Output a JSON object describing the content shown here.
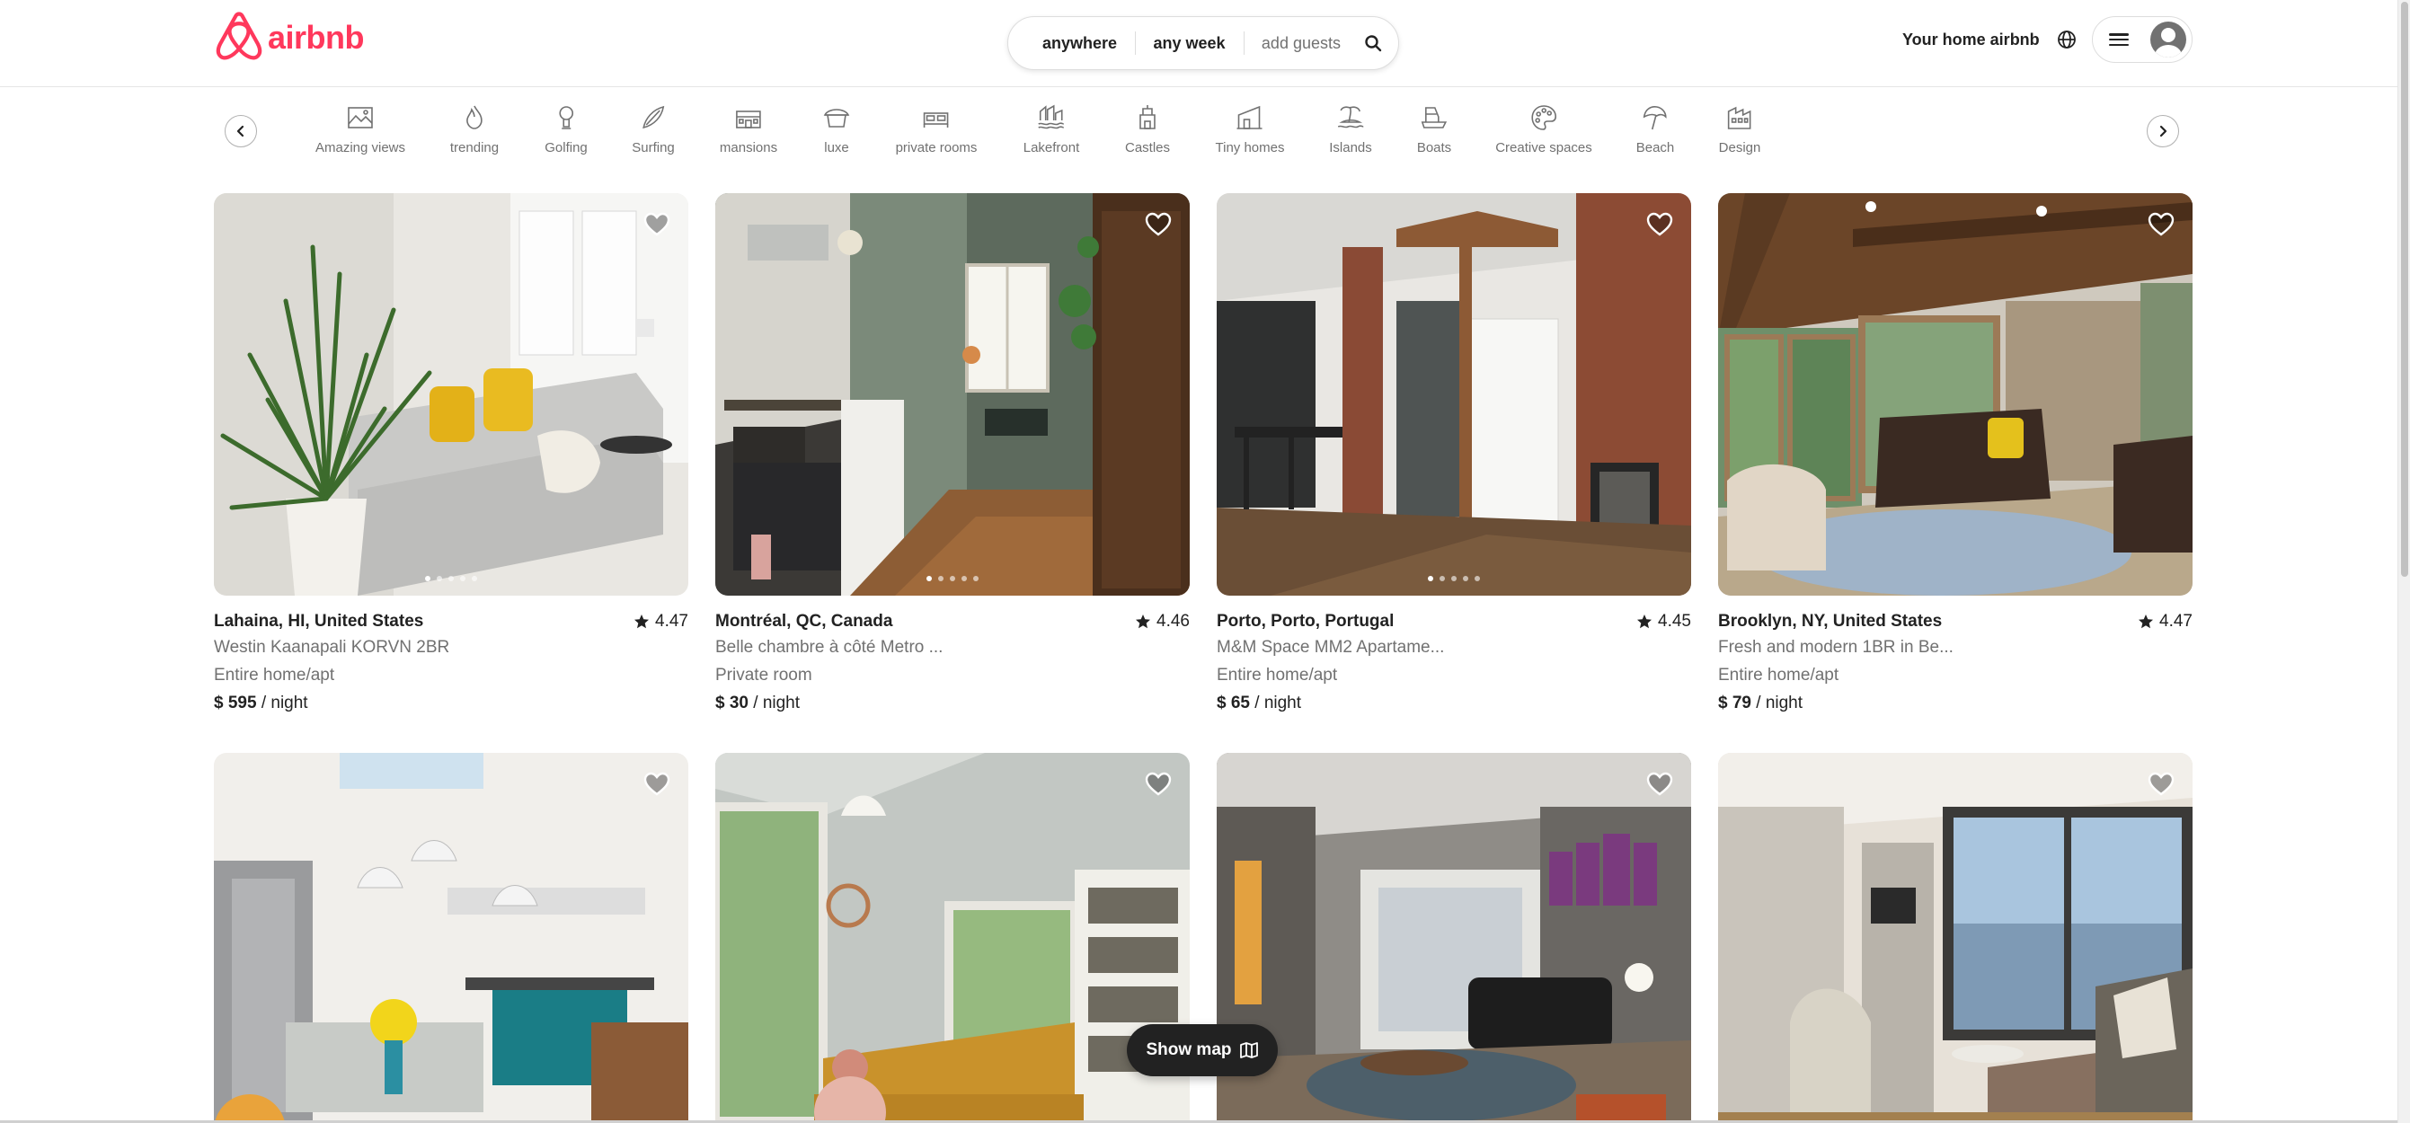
{
  "header": {
    "logo_text": "airbnb",
    "search": {
      "where": "anywhere",
      "when": "any week",
      "guests": "add guests"
    },
    "host_link": "Your home airbnb",
    "icons": {
      "search": "search-icon",
      "globe": "globe-icon",
      "menu": "hamburger-icon",
      "avatar": "user-avatar-icon"
    }
  },
  "categories": [
    {
      "label": "Amazing views",
      "icon": "amazing-views-icon"
    },
    {
      "label": "trending",
      "icon": "flame-icon"
    },
    {
      "label": "Golfing",
      "icon": "golf-icon"
    },
    {
      "label": "Surfing",
      "icon": "surfboard-icon"
    },
    {
      "label": "mansions",
      "icon": "mansion-icon"
    },
    {
      "label": "luxe",
      "icon": "luxe-icon"
    },
    {
      "label": "private rooms",
      "icon": "bed-icon"
    },
    {
      "label": "Lakefront",
      "icon": "lakefront-icon"
    },
    {
      "label": "Castles",
      "icon": "castle-icon"
    },
    {
      "label": "Tiny homes",
      "icon": "tiny-home-icon"
    },
    {
      "label": "Islands",
      "icon": "island-icon"
    },
    {
      "label": "Boats",
      "icon": "boat-icon"
    },
    {
      "label": "Creative spaces",
      "icon": "palette-icon"
    },
    {
      "label": "Beach",
      "icon": "umbrella-icon"
    },
    {
      "label": "Design",
      "icon": "design-icon"
    }
  ],
  "listings": [
    {
      "location": "Lahaina, HI, United States",
      "rating": "4.47",
      "title": "Westin Kaanapali KORVN 2BR",
      "type": "Entire home/apt",
      "price": "$ 595",
      "per": " / night"
    },
    {
      "location": "Montréal, QC, Canada",
      "rating": "4.46",
      "title": "Belle chambre à côté Metro ...",
      "type": "Private room",
      "price": "$ 30",
      "per": " / night"
    },
    {
      "location": "Porto, Porto, Portugal",
      "rating": "4.45",
      "title": "M&M Space MM2 Apartame...",
      "type": "Entire home/apt",
      "price": "$ 65",
      "per": " / night"
    },
    {
      "location": "Brooklyn, NY, United States",
      "rating": "4.47",
      "title": "Fresh and modern 1BR in Be...",
      "type": "Entire home/apt",
      "price": "$ 79",
      "per": " / night"
    }
  ],
  "show_map": {
    "label": "Show map",
    "icon": "map-icon"
  },
  "colors": {
    "brand": "#ff385c",
    "text": "#222222",
    "muted": "#717171",
    "border": "#dddddd"
  }
}
